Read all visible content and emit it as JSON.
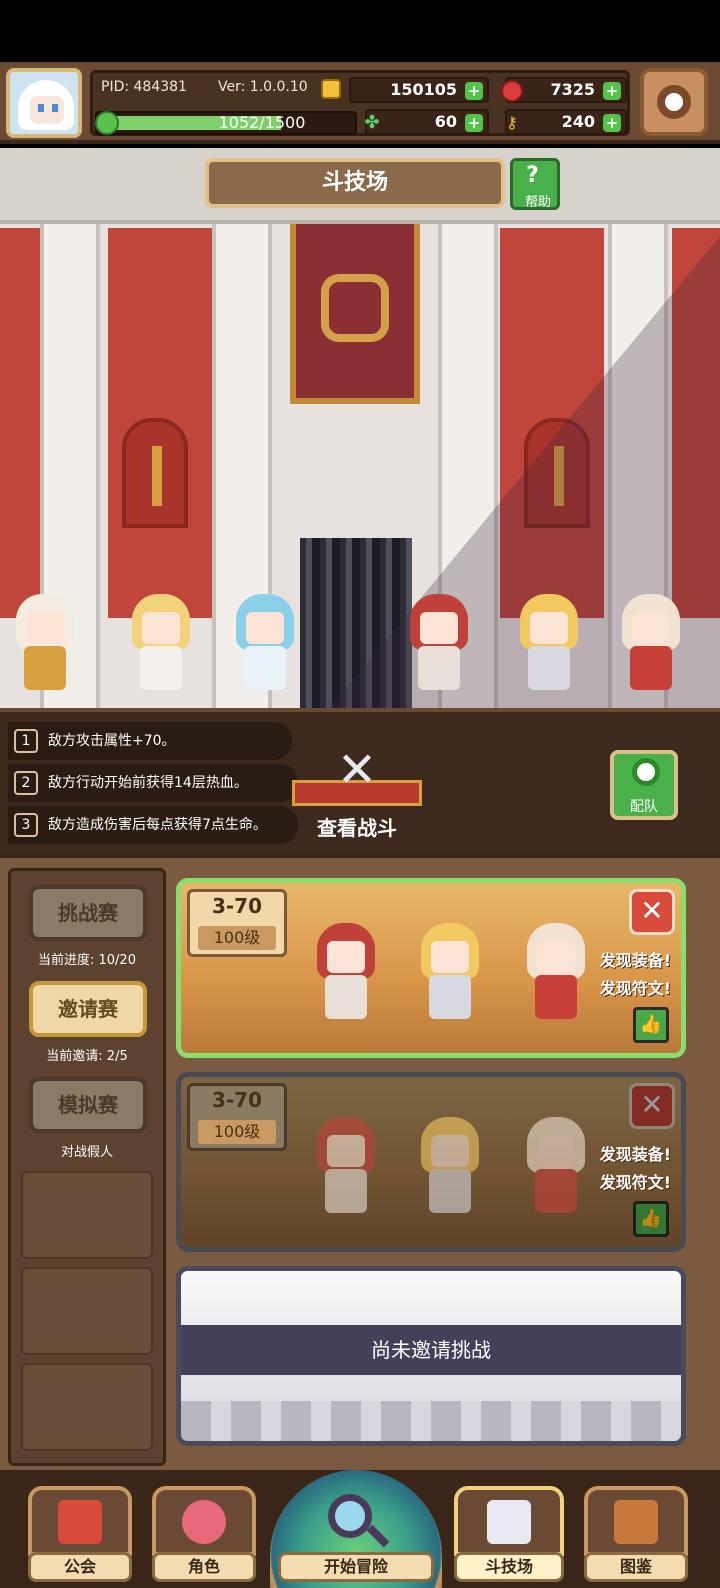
{
  "header": {
    "pid": "PID: 484381",
    "version": "Ver: 1.0.0.10",
    "gold": "150105",
    "gems": "7325",
    "clover": "60",
    "keys": "240",
    "energy_text": "1052/1500",
    "energy_fraction": 0.7
  },
  "arena": {
    "title": "斗技场",
    "help_label": "帮助"
  },
  "buffs": [
    {
      "num": "1",
      "text": "敌方攻击属性+70。"
    },
    {
      "num": "2",
      "text": "敌方行动开始前获得14层热血。"
    },
    {
      "num": "3",
      "text": "敌方造成伤害后每点获得7点生命。"
    }
  ],
  "actions": {
    "view_battle": "查看战斗",
    "team": "配队"
  },
  "sidebar": {
    "challenge": {
      "label": "挑战赛",
      "sub": "当前进度: 10/20"
    },
    "invite": {
      "label": "邀请赛",
      "sub": "当前邀请: 2/5"
    },
    "sim": {
      "label": "模拟赛",
      "sub": "对战假人"
    }
  },
  "cards": [
    {
      "stage": "3-70",
      "level": "100级",
      "find1": "发现装备!",
      "find2": "发现符文!"
    },
    {
      "stage": "3-70",
      "level": "100级",
      "find1": "发现装备!",
      "find2": "发现符文!"
    }
  ],
  "empty_card": {
    "text": "尚未邀请挑战"
  },
  "nav": {
    "guild": "公会",
    "character": "角色",
    "adventure": "开始冒险",
    "arena": "斗技场",
    "codex": "图鉴"
  },
  "icons": {
    "gold": "coin-icon",
    "gems": "gem-icon",
    "clover": "clover-icon",
    "keys": "key-icon",
    "settings": "gear-icon"
  },
  "colors": {
    "accent_green": "#52c44a",
    "gem_red": "#d83c3c",
    "frame_brown": "#6b4a34",
    "active_card_border": "#8ade6a"
  }
}
